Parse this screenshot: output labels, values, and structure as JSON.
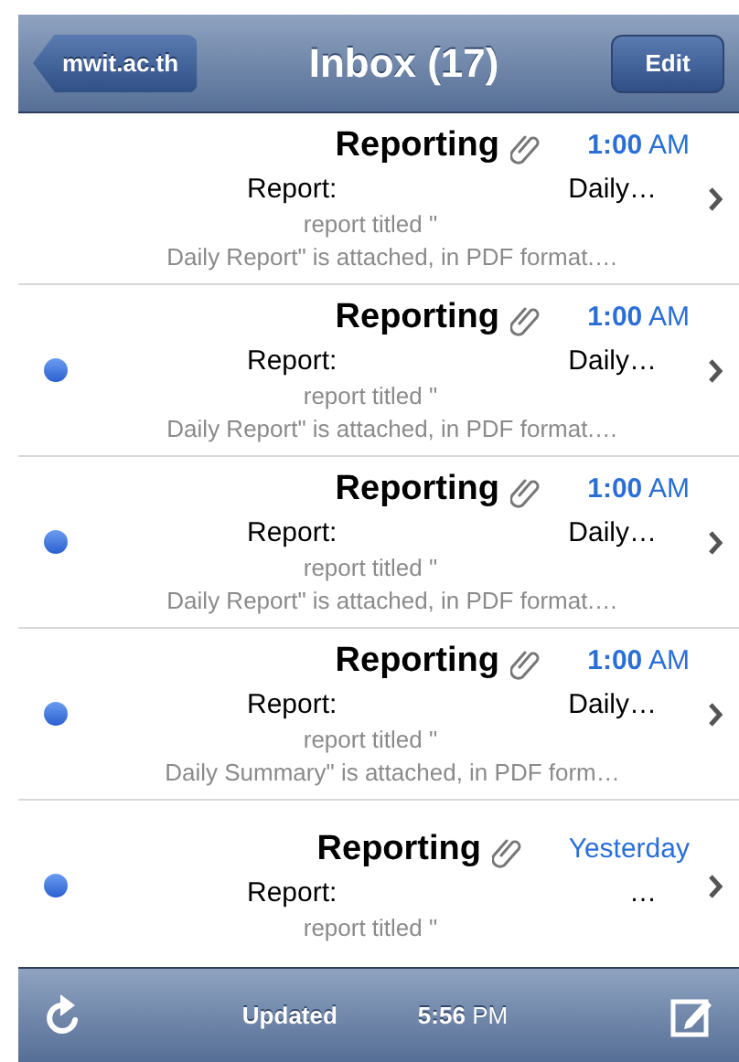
{
  "nav": {
    "back": "mwit.ac.th",
    "title": "Inbox (17)",
    "edit": "Edit"
  },
  "messages": [
    {
      "unread": false,
      "sender": "Reporting",
      "attachment": true,
      "time": "1:00",
      "meridiem": "AM",
      "subject": "Report:",
      "subject_end": "Daily…",
      "preview": [
        "report titled \"",
        "Daily Report\" is attached, in PDF format.…"
      ]
    },
    {
      "unread": true,
      "sender": "Reporting",
      "attachment": true,
      "time": "1:00",
      "meridiem": "AM",
      "subject": "Report:",
      "subject_end": "Daily…",
      "preview": [
        "report titled \"",
        "Daily Report\" is attached, in PDF format.…"
      ]
    },
    {
      "unread": true,
      "sender": "Reporting",
      "attachment": true,
      "time": "1:00",
      "meridiem": "AM",
      "subject": "Report:",
      "subject_end": "Daily…",
      "preview": [
        "report titled \"",
        "Daily Report\" is attached, in PDF format.…"
      ]
    },
    {
      "unread": true,
      "sender": "Reporting",
      "attachment": true,
      "time": "1:00",
      "meridiem": "AM",
      "subject": "Report:",
      "subject_end": "Daily…",
      "preview": [
        "report titled \"",
        "Daily Summary\" is attached, in PDF form…"
      ]
    },
    {
      "unread": true,
      "sender": "Reporting",
      "attachment": true,
      "time": "Yesterday",
      "subject": "Report:",
      "subject_end": "…",
      "preview": [
        "report titled \""
      ]
    }
  ],
  "toolbar": {
    "status": "Updated",
    "time": "5:56",
    "meridiem": "PM"
  }
}
